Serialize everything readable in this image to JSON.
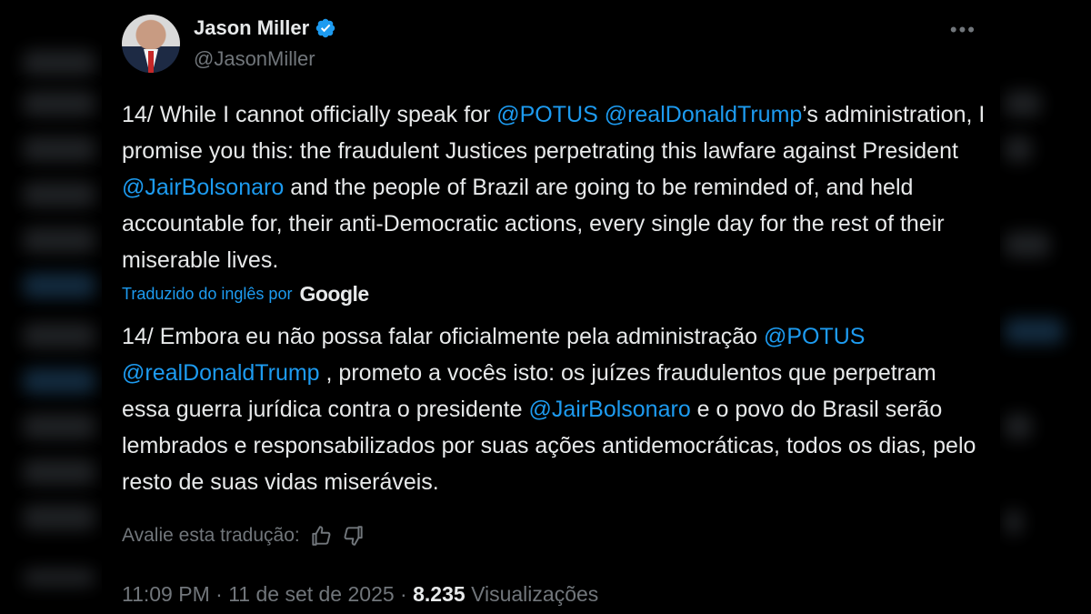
{
  "author": {
    "display_name": "Jason Miller",
    "handle": "@JasonMiller",
    "verified": true
  },
  "tweet": {
    "original_segments": [
      {
        "text": "14/ While I cannot officially speak for ",
        "mention": false
      },
      {
        "text": "@POTUS",
        "mention": true
      },
      {
        "text": " ",
        "mention": false
      },
      {
        "text": "@realDonaldTrump",
        "mention": true
      },
      {
        "text": "’s administration, I promise you this: the fraudulent Justices perpetrating this lawfare against President ",
        "mention": false
      },
      {
        "text": "@JairBolsonaro",
        "mention": true
      },
      {
        "text": " and the people of Brazil are going to be reminded of, and held accountable for, their anti-Democratic actions, every single day for the rest of their miserable lives.",
        "mention": false
      }
    ],
    "translated_label": "Traduzido do inglês por",
    "translator_brand": "Google",
    "translation_segments": [
      {
        "text": "14/ Embora eu não possa falar oficialmente pela administração ",
        "mention": false
      },
      {
        "text": "@POTUS",
        "mention": true
      },
      {
        "text": " ",
        "mention": false
      },
      {
        "text": "@realDonaldTrump",
        "mention": true
      },
      {
        "text": " , prometo a vocês isto: os juízes fraudulentos que perpetram essa guerra jurídica contra o presidente ",
        "mention": false
      },
      {
        "text": "@JairBolsonaro",
        "mention": true
      },
      {
        "text": " e o povo do Brasil serão lembrados e responsabilizados por suas ações antidemocráticas, todos os dias, pelo resto de suas vidas miseráveis.",
        "mention": false
      }
    ],
    "rate_translation_label": "Avalie esta tradução:",
    "time": "11:09 PM",
    "date": "11 de set de 2025",
    "separator": "·",
    "views_count": "8.235",
    "views_label": "Visualizações"
  },
  "icons": {
    "more": "more-options-icon",
    "verified": "verified-badge-icon",
    "thumbs_up": "thumbs-up-icon",
    "thumbs_down": "thumbs-down-icon"
  },
  "colors": {
    "background": "#000000",
    "text": "#e7e9ea",
    "secondary": "#71767b",
    "link": "#1d9bf0"
  }
}
